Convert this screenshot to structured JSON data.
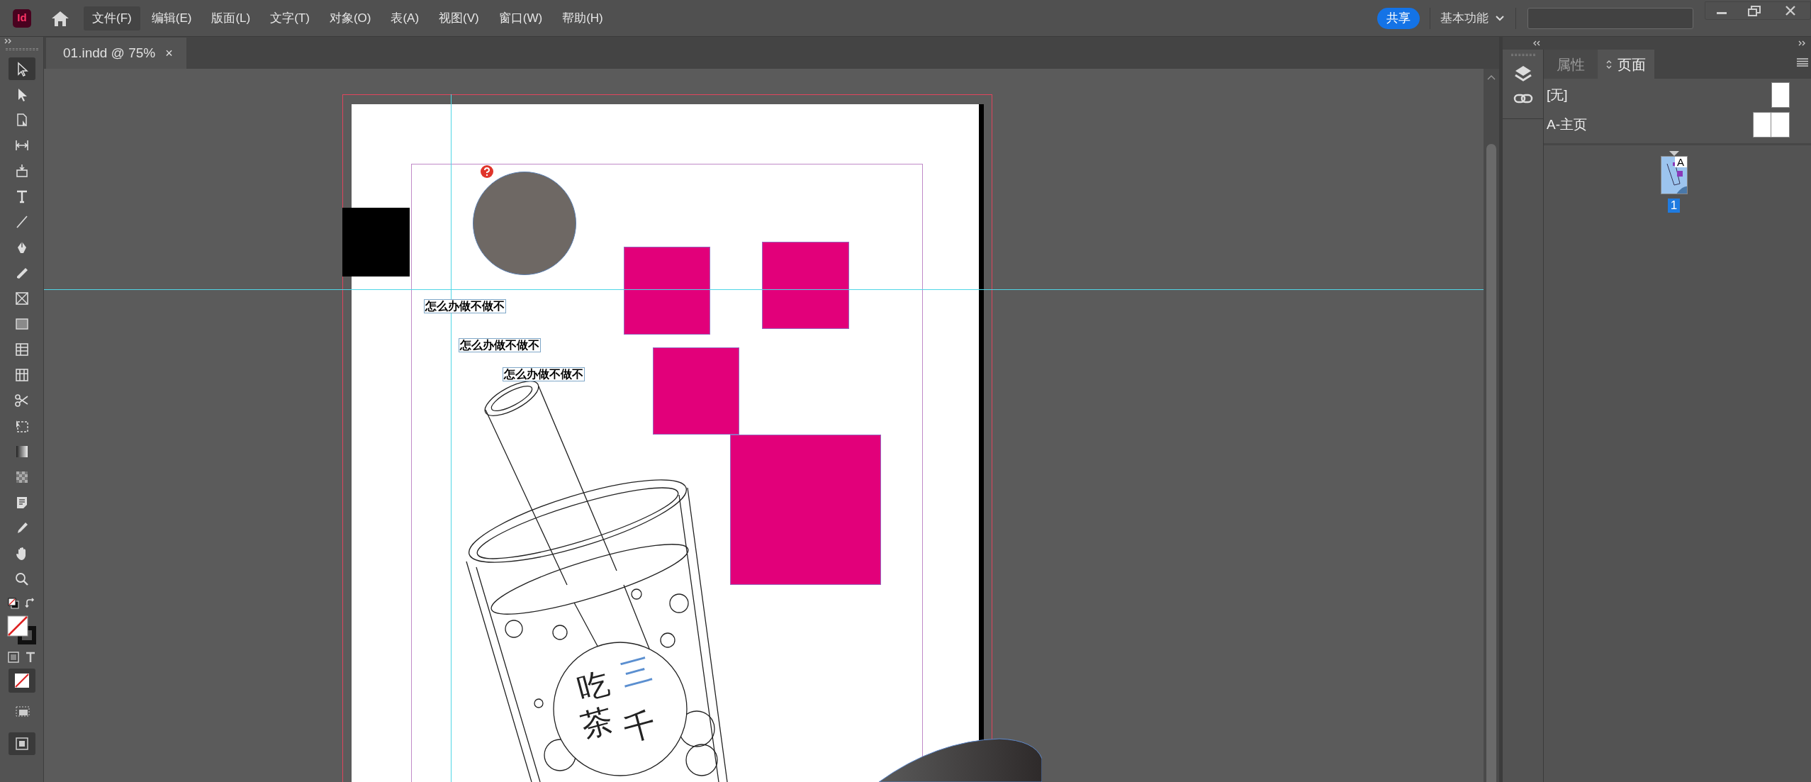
{
  "app": {
    "logo": "Id"
  },
  "menu": [
    {
      "label": "文件(F)",
      "selected": true
    },
    {
      "label": "编辑(E)",
      "selected": false
    },
    {
      "label": "版面(L)",
      "selected": false
    },
    {
      "label": "文字(T)",
      "selected": false
    },
    {
      "label": "对象(O)",
      "selected": false
    },
    {
      "label": "表(A)",
      "selected": false
    },
    {
      "label": "视图(V)",
      "selected": false
    },
    {
      "label": "窗口(W)",
      "selected": false
    },
    {
      "label": "帮助(H)",
      "selected": false
    }
  ],
  "share_button": "共享",
  "workspace": "基本功能",
  "document_tab": {
    "title": "01.indd @ 75%",
    "close": "×"
  },
  "tools": [
    {
      "kind": "selection",
      "selected": true
    },
    {
      "kind": "direct",
      "selected": false
    },
    {
      "kind": "page",
      "selected": false
    },
    {
      "kind": "gap",
      "selected": false
    },
    {
      "kind": "collector",
      "selected": false
    },
    {
      "kind": "type",
      "selected": false
    },
    {
      "kind": "line",
      "selected": false
    },
    {
      "kind": "pen",
      "selected": false
    },
    {
      "kind": "pencil",
      "selected": false
    },
    {
      "kind": "frame",
      "selected": false
    },
    {
      "kind": "rectangle",
      "selected": false
    },
    {
      "kind": "table-rows",
      "selected": false
    },
    {
      "kind": "table-cols",
      "selected": false
    },
    {
      "kind": "scissors",
      "selected": false
    },
    {
      "kind": "transform",
      "selected": false
    },
    {
      "kind": "gradient",
      "selected": false
    },
    {
      "kind": "feather",
      "selected": false
    },
    {
      "kind": "note",
      "selected": false
    },
    {
      "kind": "eyedropper",
      "selected": false
    },
    {
      "kind": "hand",
      "selected": false
    },
    {
      "kind": "zoom",
      "selected": false
    }
  ],
  "canvas": {
    "photo": {
      "missing_link": true
    },
    "text_frames": [
      {
        "text": "怎么办做不做不"
      },
      {
        "text": "怎么办做不做不"
      },
      {
        "text": "怎么办做不做不"
      }
    ],
    "logo_chars": [
      {
        "text": "吃",
        "color": "#222222"
      },
      {
        "text": "三",
        "color": "#5b8fd0"
      },
      {
        "text": "茶",
        "color": "#222222"
      },
      {
        "text": "千",
        "color": "#222222"
      }
    ]
  },
  "panel": {
    "tabs": [
      {
        "label": "属性",
        "selected": false
      },
      {
        "label": "页面",
        "selected": true
      }
    ],
    "masters": [
      {
        "label": "[无]",
        "kind": "single"
      },
      {
        "label": "A-主页",
        "kind": "spread"
      }
    ],
    "pages": [
      {
        "number": "1",
        "master": "A",
        "selected": true
      }
    ]
  }
}
